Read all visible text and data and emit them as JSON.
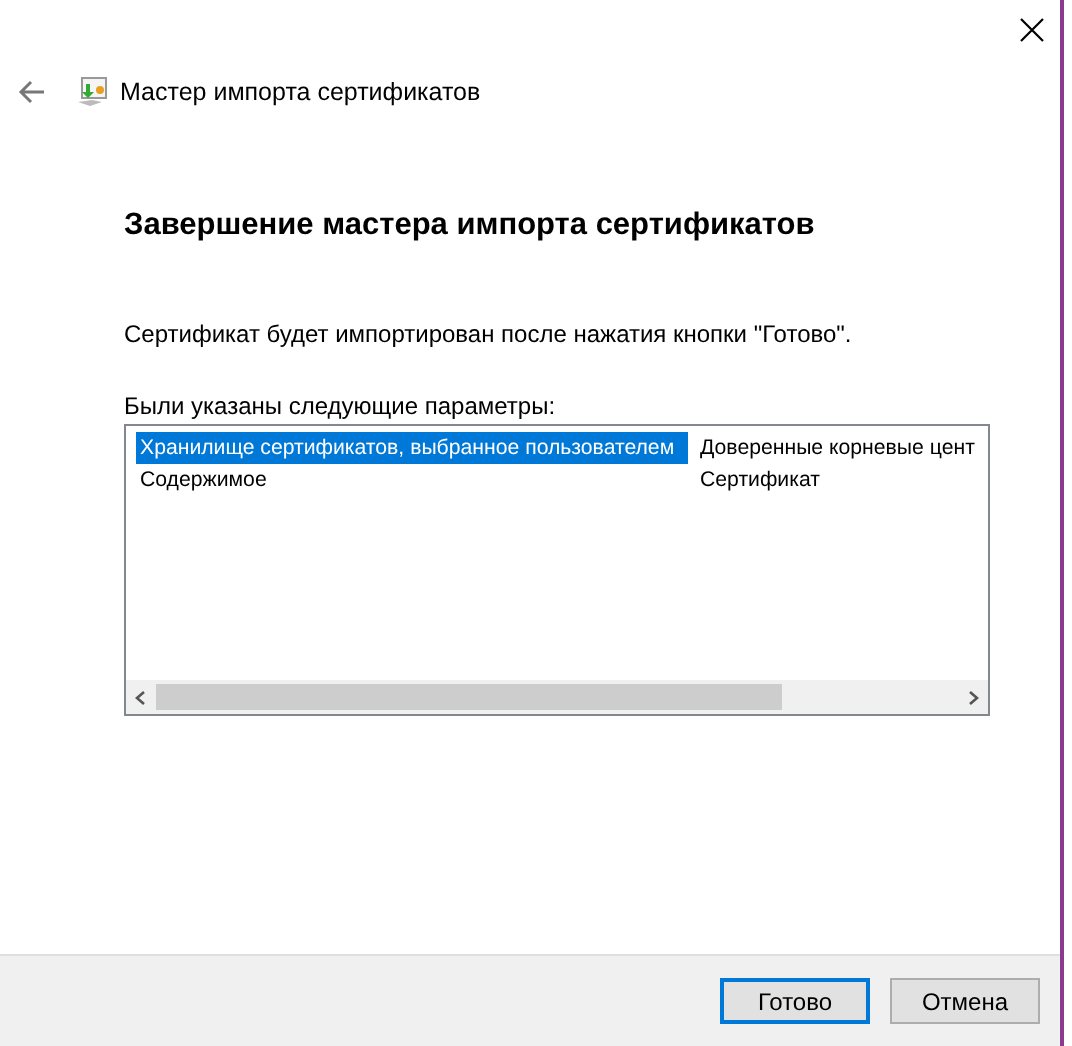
{
  "window": {
    "title": "Мастер импорта сертификатов"
  },
  "heading": "Завершение мастера импорта сертификатов",
  "description": "Сертификат будет импортирован после нажатия кнопки \"Готово\".",
  "parameters": {
    "label": "Были указаны следующие параметры:",
    "rows": [
      {
        "name": "Хранилище сертификатов, выбранное пользователем",
        "value": "Доверенные корневые цент",
        "selected": true
      },
      {
        "name": "Содержимое",
        "value": "Сертификат",
        "selected": false
      }
    ]
  },
  "buttons": [
    {
      "label": "Готово",
      "default": true
    },
    {
      "label": "Отмена",
      "default": false
    }
  ]
}
